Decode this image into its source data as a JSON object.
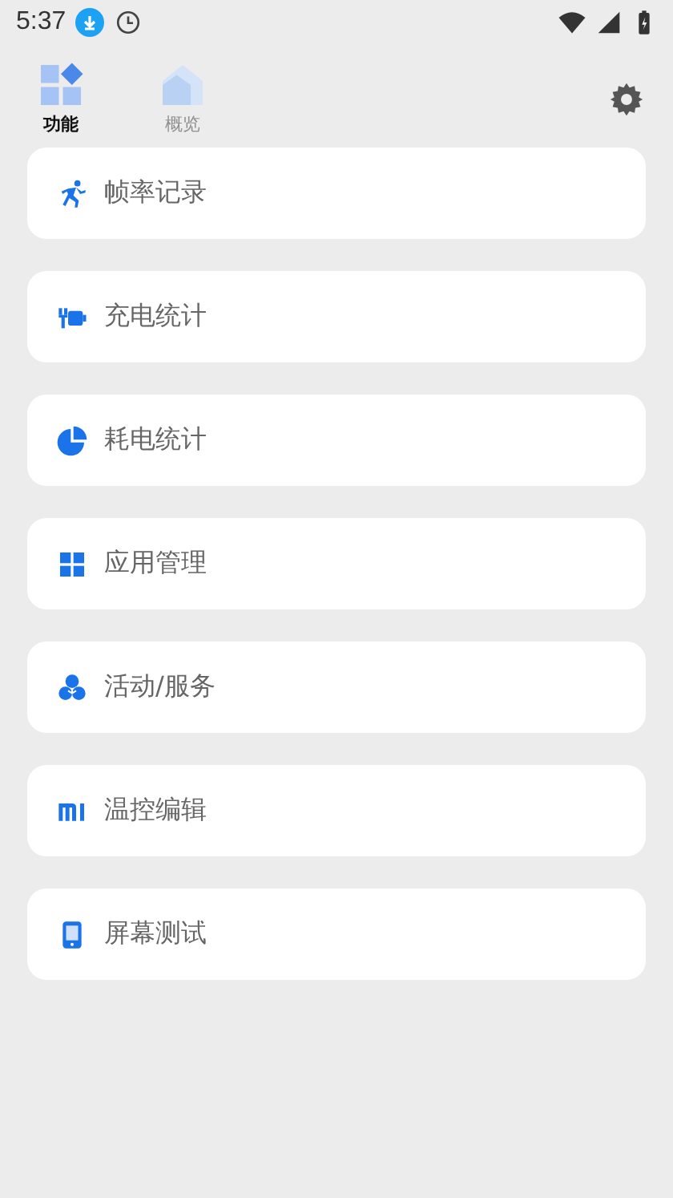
{
  "status_bar": {
    "time": "5:37"
  },
  "tabs": [
    {
      "label": "功能",
      "selected": true,
      "kind": "blocks"
    },
    {
      "label": "概览",
      "selected": false,
      "kind": "house"
    }
  ],
  "items": [
    {
      "label": "帧率记录",
      "kind": "run"
    },
    {
      "label": "充电统计",
      "kind": "plug"
    },
    {
      "label": "耗电统计",
      "kind": "pie"
    },
    {
      "label": "应用管理",
      "kind": "grid"
    },
    {
      "label": "活动/服务",
      "kind": "circles"
    },
    {
      "label": "温控编辑",
      "kind": "mi"
    },
    {
      "label": "屏幕测试",
      "kind": "phone"
    }
  ]
}
